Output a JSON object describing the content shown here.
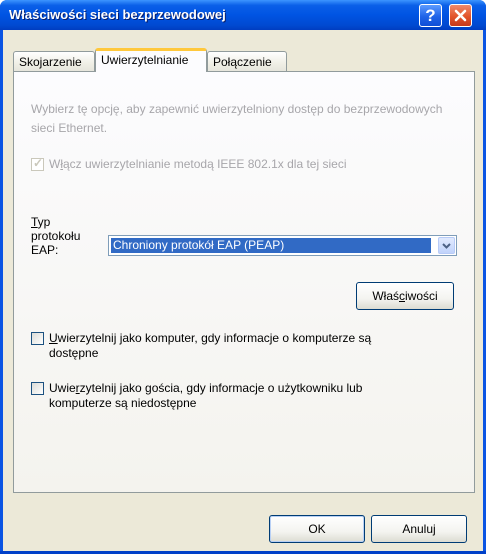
{
  "window": {
    "title": "Właściwości sieci bezprzewodowej"
  },
  "tabs": [
    {
      "label": "Skojarzenie"
    },
    {
      "label": "Uwierzytelnianie"
    },
    {
      "label": "Połączenie"
    }
  ],
  "auth": {
    "description": "Wybierz tę opcję, aby zapewnić uwierzytelniony dostęp do bezprzewodowych sieci Ethernet.",
    "enable_8021x": {
      "label_pre": "W",
      "label_u": "ł",
      "label_post": "ącz uwierzytelnianie metodą IEEE 802.1x dla tej sieci",
      "checked": true,
      "disabled": true
    },
    "eap_type": {
      "label_u": "T",
      "label_line1_rest": "yp",
      "label_line2": "protokołu",
      "label_line3": "EAP:",
      "selected": "Chroniony protokół EAP (PEAP)"
    },
    "properties_button": {
      "pre": "Właś",
      "u": "c",
      "post": "iwości"
    },
    "auth_as_computer": {
      "u": "U",
      "rest_line1": "wierzytelnij jako komputer, gdy informacje o komputerze są",
      "line2": "dostępne",
      "checked": false
    },
    "auth_as_guest": {
      "pre": "Uwie",
      "u": "r",
      "rest_line1": "zytelnij jako gościa, gdy informacje o użytkowniku lub",
      "line2": "komputerze są niedostępne",
      "checked": false
    }
  },
  "buttons": {
    "ok": "OK",
    "cancel": "Anuluj"
  },
  "colors": {
    "title_bar": "#0054e3",
    "dialog_bg": "#ece9d8",
    "selection": "#316ac5",
    "close_button": "#e2542b"
  }
}
